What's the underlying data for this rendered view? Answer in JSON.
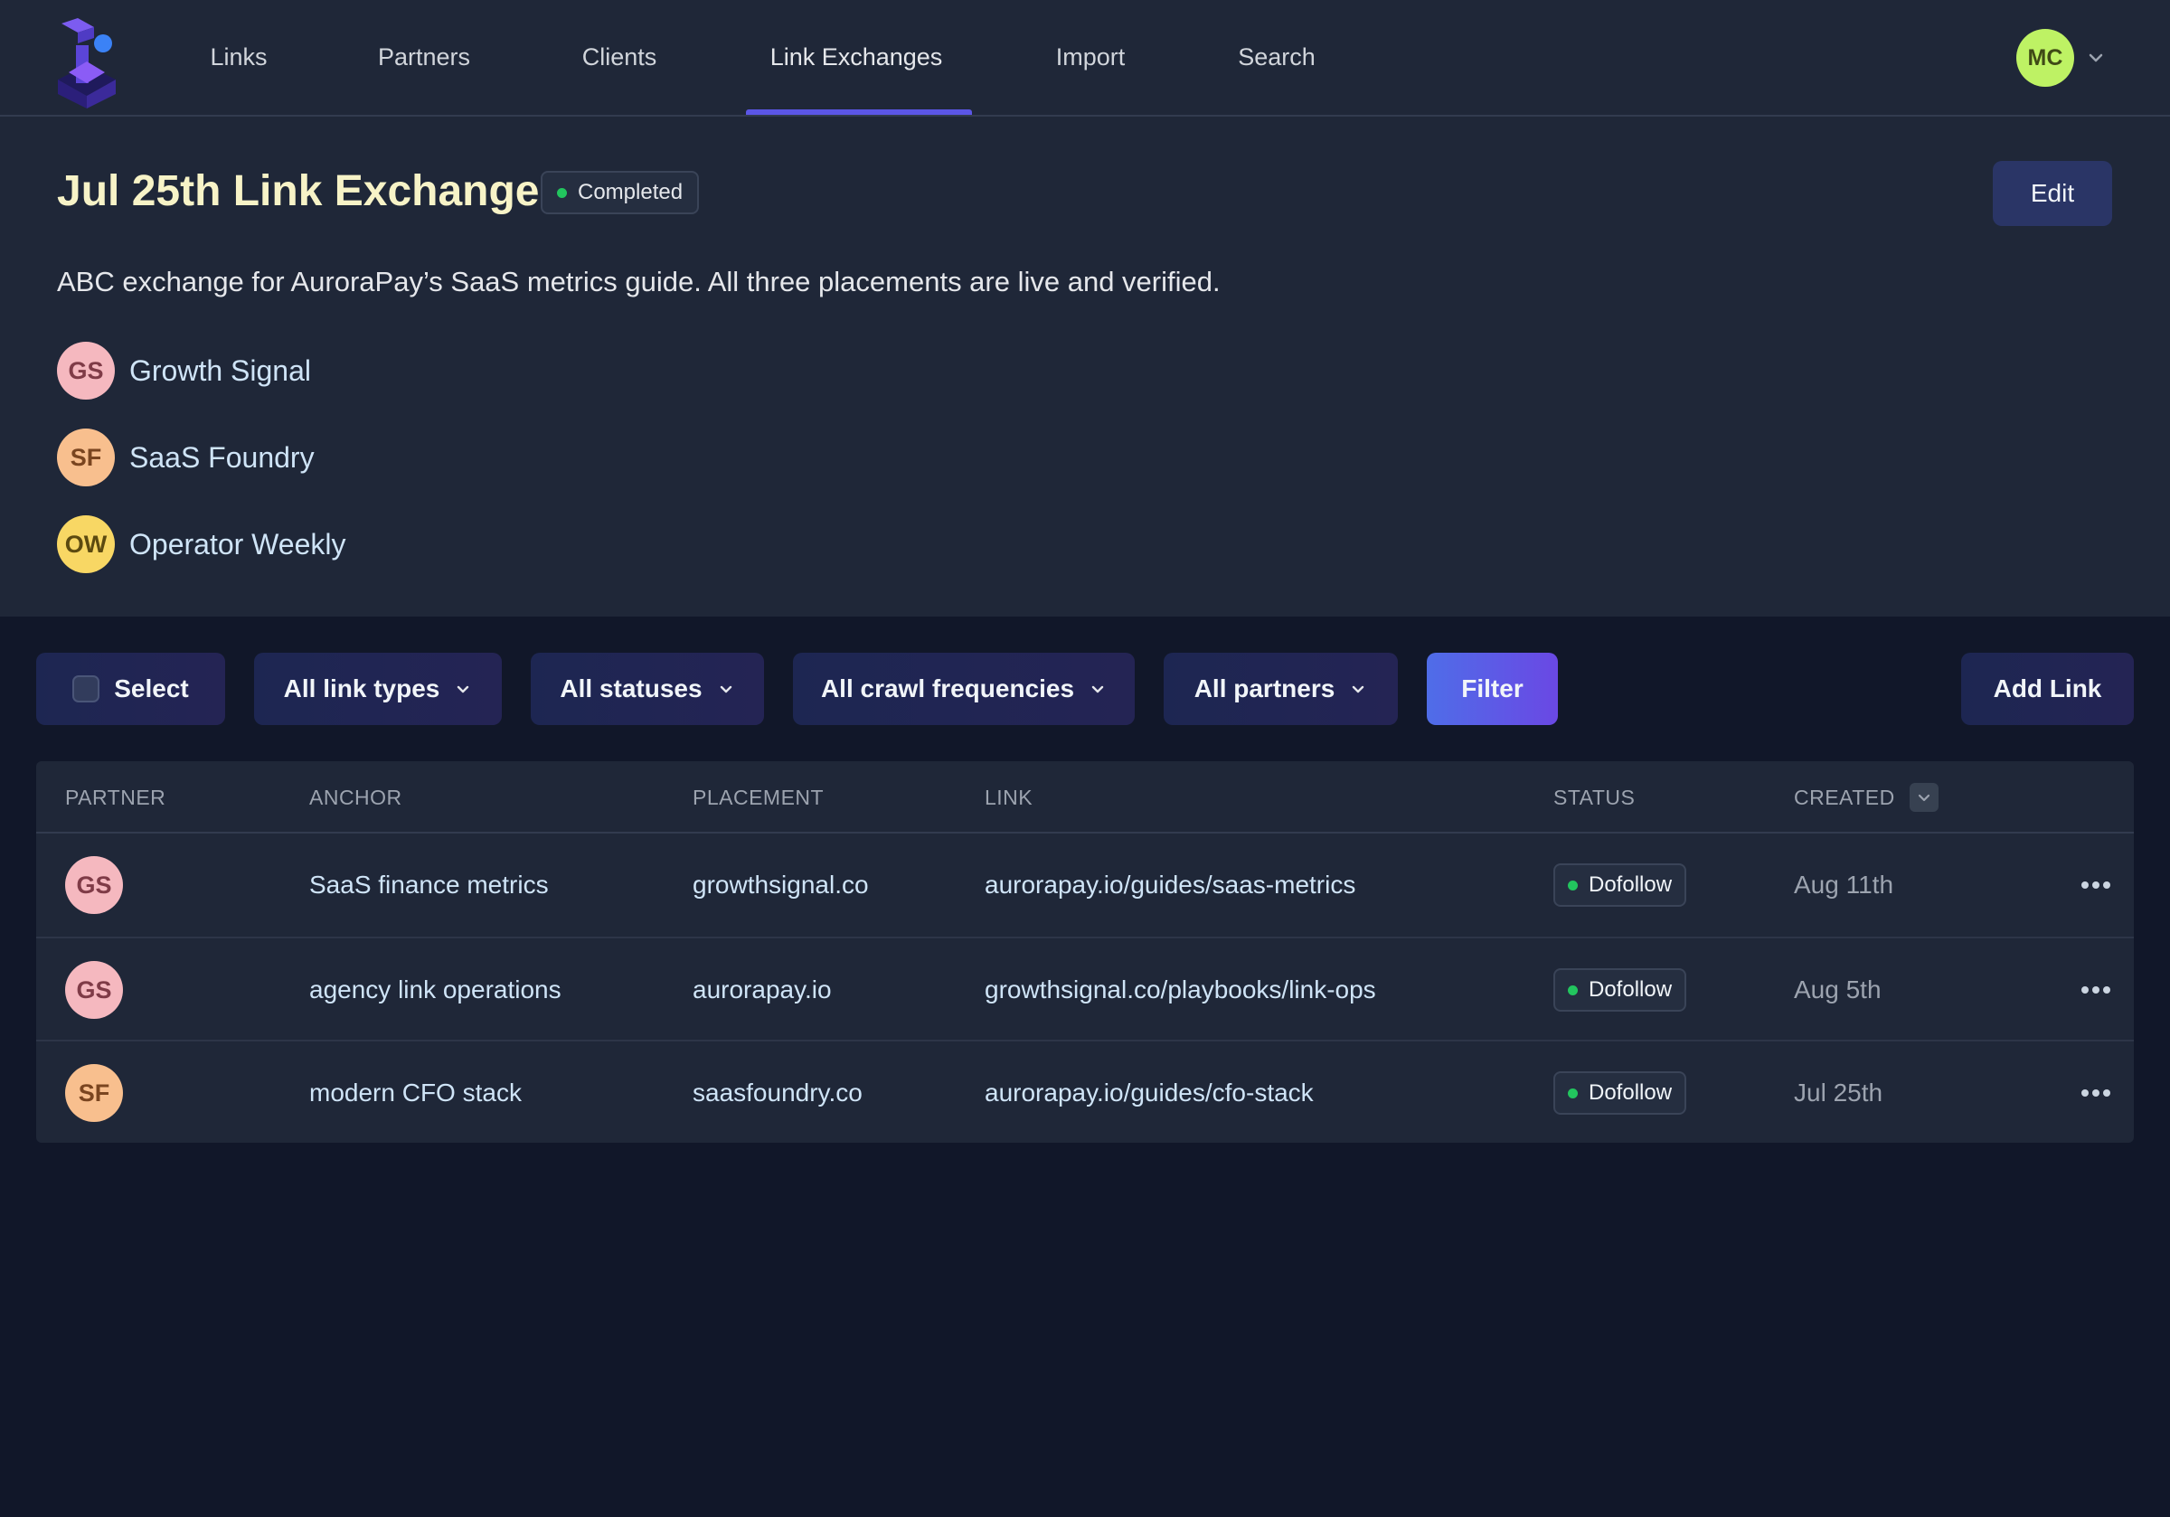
{
  "nav": {
    "items": [
      {
        "label": "Links"
      },
      {
        "label": "Partners"
      },
      {
        "label": "Clients"
      },
      {
        "label": "Link Exchanges",
        "active": true
      },
      {
        "label": "Import"
      },
      {
        "label": "Search"
      }
    ],
    "user_initials": "MC"
  },
  "header": {
    "title": "Jul 25th Link Exchange",
    "status": "Completed",
    "edit_label": "Edit",
    "description": "ABC exchange for AuroraPay’s SaaS metrics guide. All three placements are live and verified.",
    "partners": [
      {
        "initials": "GS",
        "name": "Growth Signal",
        "color": "#f5b8bf",
        "text_color": "#7f3b47"
      },
      {
        "initials": "SF",
        "name": "SaaS Foundry",
        "color": "#f8bf8e",
        "text_color": "#7a4520"
      },
      {
        "initials": "OW",
        "name": "Operator Weekly",
        "color": "#f8d764",
        "text_color": "#5c4a10"
      }
    ]
  },
  "toolbar": {
    "select_label": "Select",
    "link_types": "All link types",
    "statuses": "All statuses",
    "crawl": "All crawl frequencies",
    "partners": "All partners",
    "filter": "Filter",
    "add_link": "Add Link"
  },
  "table": {
    "columns": [
      "PARTNER",
      "ANCHOR",
      "PLACEMENT",
      "LINK",
      "STATUS",
      "CREATED"
    ],
    "rows": [
      {
        "partner": "GS",
        "anchor": "SaaS finance metrics",
        "placement": "growthsignal.co",
        "link": "aurorapay.io/guides/saas-metrics",
        "status": "Dofollow",
        "created": "Aug 11th"
      },
      {
        "partner": "GS",
        "anchor": "agency link operations",
        "placement": "aurorapay.io",
        "link": "growthsignal.co/playbooks/link-ops",
        "status": "Dofollow",
        "created": "Aug 5th"
      },
      {
        "partner": "SF",
        "anchor": "modern CFO stack",
        "placement": "saasfoundry.co",
        "link": "aurorapay.io/guides/cfo-stack",
        "status": "Dofollow",
        "created": "Jul 25th"
      }
    ]
  },
  "colors": {
    "accent": "#5b56e6",
    "status_green": "#22c55e",
    "gs_avatar": "#f5b8bf",
    "sf_avatar": "#f8bf8e"
  }
}
